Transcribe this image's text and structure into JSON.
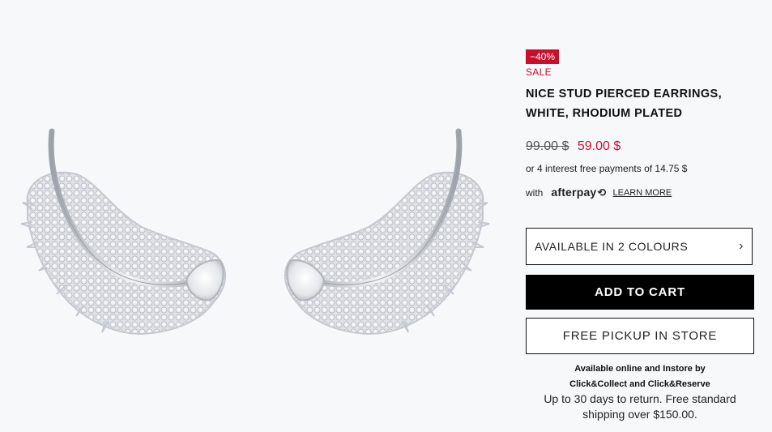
{
  "product": {
    "badge": "−40%",
    "sale_label": "SALE",
    "title": "NICE STUD PIERCED EARRINGS, WHITE, RHODIUM PLATED",
    "old_price": "99.00 $",
    "new_price": "59.00 $",
    "installments": "or 4 interest free payments of 14.75 $",
    "afterpay_prefix": "with",
    "afterpay_brand": "afterpay",
    "learn_more": "LEARN MORE"
  },
  "actions": {
    "colours": "AVAILABLE IN 2 COLOURS",
    "add_to_cart": "ADD TO CART",
    "pickup": "FREE PICKUP IN STORE"
  },
  "info": {
    "availability_line1": "Available online and Instore by",
    "availability_line2": "Click&Collect and Click&Reserve",
    "returns_line1": "Up to 30 days to return. Free standard",
    "returns_line2": "shipping over $150.00."
  },
  "icons": {
    "chevron": "chevron-right-icon",
    "afterpay_mark": "afterpay-logo-icon",
    "product_image": "earrings-image"
  },
  "colors": {
    "sale": "#c8102e",
    "button_dark": "#000000",
    "background": "#f7f8fa"
  }
}
